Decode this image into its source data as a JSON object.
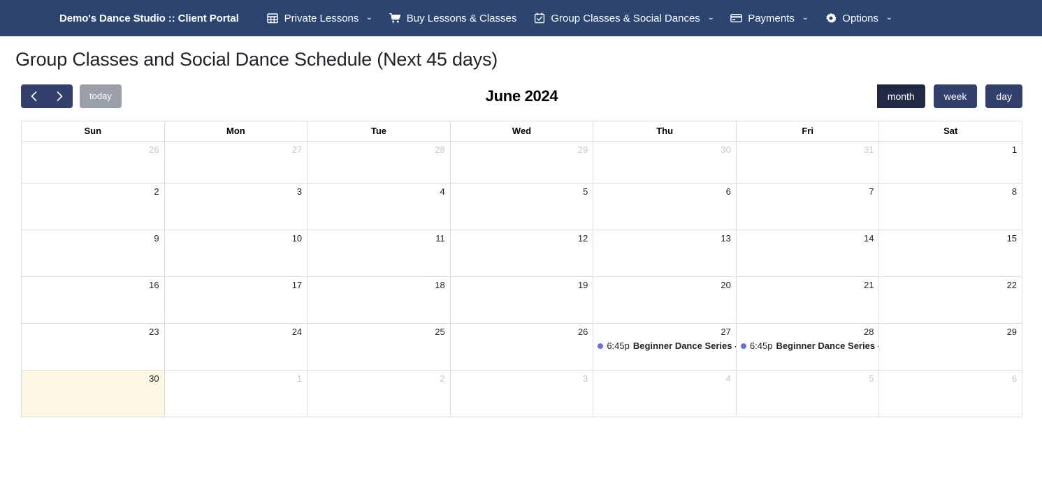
{
  "navbar": {
    "brand": "Demo's Dance Studio :: Client Portal",
    "items": [
      {
        "label": "Private Lessons",
        "icon": "calendar-table-icon",
        "caret": "⌄",
        "has_caret": true
      },
      {
        "label": "Buy Lessons & Classes",
        "icon": "shopping-cart-icon",
        "caret": "",
        "has_caret": false
      },
      {
        "label": "Group Classes & Social Dances",
        "icon": "calendar-check-icon",
        "caret": "⌄",
        "has_caret": true
      },
      {
        "label": "Payments",
        "icon": "credit-card-icon",
        "caret": "⌄",
        "has_caret": true
      },
      {
        "label": "Options",
        "icon": "gear-icon",
        "caret": "⌄",
        "has_caret": true
      }
    ]
  },
  "page": {
    "title": "Group Classes and Social Dance Schedule (Next 45 days)"
  },
  "toolbar": {
    "prev_label": "‹",
    "next_label": "›",
    "today_label": "today",
    "title": "June 2024",
    "views": [
      {
        "label": "month",
        "active": true
      },
      {
        "label": "week",
        "active": false
      },
      {
        "label": "day",
        "active": false
      }
    ]
  },
  "calendar": {
    "day_headers": [
      "Sun",
      "Mon",
      "Tue",
      "Wed",
      "Thu",
      "Fri",
      "Sat"
    ],
    "accent_event_color": "#6572e4",
    "today_highlight_color": "#fcf8e3",
    "weeks": [
      [
        {
          "num": "26",
          "other": true,
          "today": false,
          "events": []
        },
        {
          "num": "27",
          "other": true,
          "today": false,
          "events": []
        },
        {
          "num": "28",
          "other": true,
          "today": false,
          "events": []
        },
        {
          "num": "29",
          "other": true,
          "today": false,
          "events": []
        },
        {
          "num": "30",
          "other": true,
          "today": false,
          "events": []
        },
        {
          "num": "31",
          "other": true,
          "today": false,
          "events": []
        },
        {
          "num": "1",
          "other": false,
          "today": false,
          "events": []
        }
      ],
      [
        {
          "num": "2",
          "other": false,
          "today": false,
          "events": []
        },
        {
          "num": "3",
          "other": false,
          "today": false,
          "events": []
        },
        {
          "num": "4",
          "other": false,
          "today": false,
          "events": []
        },
        {
          "num": "5",
          "other": false,
          "today": false,
          "events": []
        },
        {
          "num": "6",
          "other": false,
          "today": false,
          "events": []
        },
        {
          "num": "7",
          "other": false,
          "today": false,
          "events": []
        },
        {
          "num": "8",
          "other": false,
          "today": false,
          "events": []
        }
      ],
      [
        {
          "num": "9",
          "other": false,
          "today": false,
          "events": []
        },
        {
          "num": "10",
          "other": false,
          "today": false,
          "events": []
        },
        {
          "num": "11",
          "other": false,
          "today": false,
          "events": []
        },
        {
          "num": "12",
          "other": false,
          "today": false,
          "events": []
        },
        {
          "num": "13",
          "other": false,
          "today": false,
          "events": []
        },
        {
          "num": "14",
          "other": false,
          "today": false,
          "events": []
        },
        {
          "num": "15",
          "other": false,
          "today": false,
          "events": []
        }
      ],
      [
        {
          "num": "16",
          "other": false,
          "today": false,
          "events": []
        },
        {
          "num": "17",
          "other": false,
          "today": false,
          "events": []
        },
        {
          "num": "18",
          "other": false,
          "today": false,
          "events": []
        },
        {
          "num": "19",
          "other": false,
          "today": false,
          "events": []
        },
        {
          "num": "20",
          "other": false,
          "today": false,
          "events": []
        },
        {
          "num": "21",
          "other": false,
          "today": false,
          "events": []
        },
        {
          "num": "22",
          "other": false,
          "today": false,
          "events": []
        }
      ],
      [
        {
          "num": "23",
          "other": false,
          "today": false,
          "events": []
        },
        {
          "num": "24",
          "other": false,
          "today": false,
          "events": []
        },
        {
          "num": "25",
          "other": false,
          "today": false,
          "events": []
        },
        {
          "num": "26",
          "other": false,
          "today": false,
          "events": []
        },
        {
          "num": "27",
          "other": false,
          "today": false,
          "events": [
            {
              "time": "6:45p",
              "title": "Beginner Dance Series -"
            }
          ]
        },
        {
          "num": "28",
          "other": false,
          "today": false,
          "events": [
            {
              "time": "6:45p",
              "title": "Beginner Dance Series -"
            }
          ]
        },
        {
          "num": "29",
          "other": false,
          "today": false,
          "events": []
        }
      ],
      [
        {
          "num": "30",
          "other": false,
          "today": true,
          "events": []
        },
        {
          "num": "1",
          "other": true,
          "today": false,
          "events": []
        },
        {
          "num": "2",
          "other": true,
          "today": false,
          "events": []
        },
        {
          "num": "3",
          "other": true,
          "today": false,
          "events": []
        },
        {
          "num": "4",
          "other": true,
          "today": false,
          "events": []
        },
        {
          "num": "5",
          "other": true,
          "today": false,
          "events": []
        },
        {
          "num": "6",
          "other": true,
          "today": false,
          "events": []
        }
      ]
    ]
  }
}
